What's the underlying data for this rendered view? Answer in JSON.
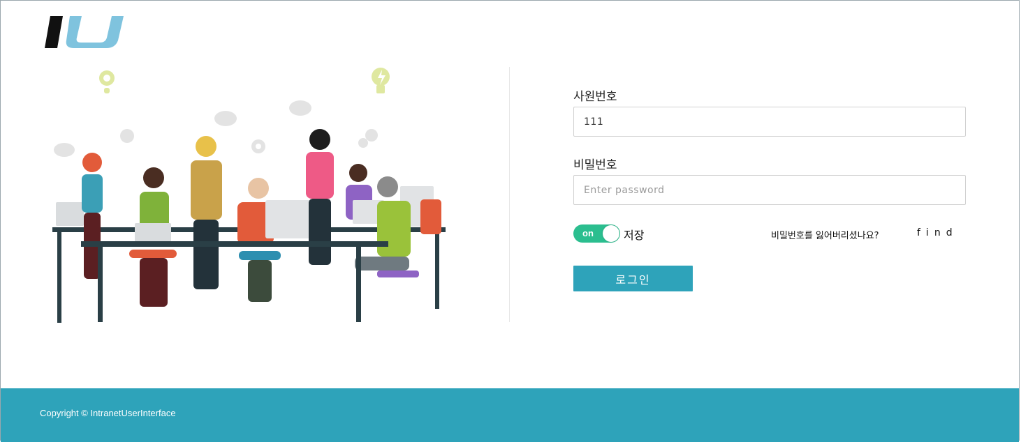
{
  "logo": {
    "text": "IU"
  },
  "form": {
    "employee_id_label": "사원번호",
    "employee_id_value": "111",
    "password_label": "비밀번호",
    "password_placeholder": "Enter password",
    "toggle_text": "on",
    "save_label": "저장",
    "forgot_text": "비밀번호를 잃어버리셨나요?",
    "find_link": "find",
    "login_button": "로그인"
  },
  "footer": {
    "copyright": "Copyright © IntranetUserInterface"
  },
  "colors": {
    "accent": "#2ea3ba",
    "toggle": "#2bbe8f",
    "logo_dark": "#111111",
    "logo_light": "#7fc3de"
  }
}
